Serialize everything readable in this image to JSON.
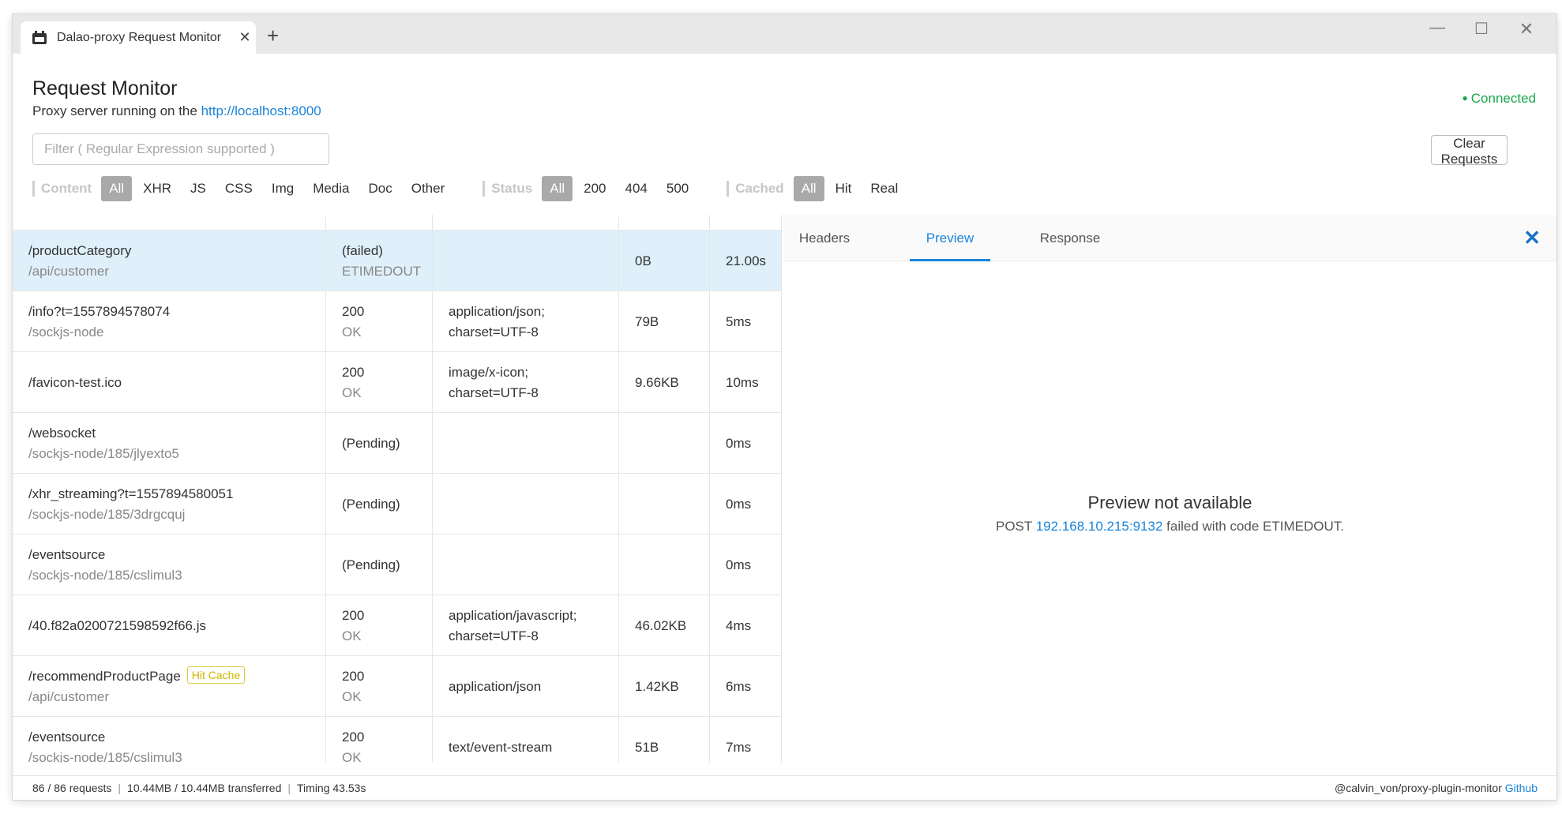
{
  "window": {
    "tab_title": "Dalao-proxy Request Monitor",
    "close_glyph": "✕",
    "new_tab_glyph": "+",
    "min_glyph": "—",
    "max_glyph": "☐",
    "close_window_glyph": "✕"
  },
  "header": {
    "title": "Request Monitor",
    "subtitle_prefix": "Proxy server running on the ",
    "server_url": "http://localhost:8000",
    "connection_status": "Connected",
    "connection_color": "#19a84a"
  },
  "toolbar": {
    "filter_placeholder": "Filter ( Regular Expression supported )",
    "filter_value": "",
    "clear_label": "Clear Requests"
  },
  "filters": {
    "content": {
      "label": "Content",
      "options": [
        "All",
        "XHR",
        "JS",
        "CSS",
        "Img",
        "Media",
        "Doc",
        "Other"
      ],
      "selected": "All"
    },
    "status": {
      "label": "Status",
      "options": [
        "All",
        "200",
        "404",
        "500"
      ],
      "selected": "All"
    },
    "cached": {
      "label": "Cached",
      "options": [
        "All",
        "Hit",
        "Real"
      ],
      "selected": "All"
    }
  },
  "requests": [
    {
      "name": "",
      "path": "/api/customer",
      "status": "",
      "status_text": "ETIMEDOUT",
      "type": "",
      "size": "",
      "time": "",
      "badge": ""
    },
    {
      "name": "/productCategory",
      "path": "/api/customer",
      "status": "(failed)",
      "status_text": "ETIMEDOUT",
      "type": "",
      "size": "0B",
      "time": "21.00s",
      "badge": "",
      "selected": true
    },
    {
      "name": "/info?t=1557894578074",
      "path": "/sockjs-node",
      "status": "200",
      "status_text": "OK",
      "type": "application/json;\ncharset=UTF-8",
      "size": "79B",
      "time": "5ms",
      "badge": ""
    },
    {
      "name": "/favicon-test.ico",
      "path": "",
      "status": "200",
      "status_text": "OK",
      "type": "image/x-icon;\ncharset=UTF-8",
      "size": "9.66KB",
      "time": "10ms",
      "badge": ""
    },
    {
      "name": "/websocket",
      "path": "/sockjs-node/185/jlyexto5",
      "status": "(Pending)",
      "status_text": "",
      "type": "",
      "size": "",
      "time": "0ms",
      "badge": ""
    },
    {
      "name": "/xhr_streaming?t=1557894580051",
      "path": "/sockjs-node/185/3drgcquj",
      "status": "(Pending)",
      "status_text": "",
      "type": "",
      "size": "",
      "time": "0ms",
      "badge": ""
    },
    {
      "name": "/eventsource",
      "path": "/sockjs-node/185/cslimul3",
      "status": "(Pending)",
      "status_text": "",
      "type": "",
      "size": "",
      "time": "0ms",
      "badge": ""
    },
    {
      "name": "/40.f82a0200721598592f66.js",
      "path": "",
      "status": "200",
      "status_text": "OK",
      "type": "application/javascript;\ncharset=UTF-8",
      "size": "46.02KB",
      "time": "4ms",
      "badge": ""
    },
    {
      "name": "/recommendProductPage",
      "path": "/api/customer",
      "status": "200",
      "status_text": "OK",
      "type": "application/json",
      "size": "1.42KB",
      "time": "6ms",
      "badge": "Hit Cache"
    },
    {
      "name": "/eventsource",
      "path": "/sockjs-node/185/cslimul3",
      "status": "200",
      "status_text": "OK",
      "type": "text/event-stream",
      "size": "51B",
      "time": "7ms",
      "badge": ""
    }
  ],
  "detail": {
    "tabs": [
      "Headers",
      "Preview",
      "Response"
    ],
    "active_tab": "Preview",
    "close_glyph": "✕",
    "preview_title": "Preview not available",
    "preview_method": "POST ",
    "preview_ip": "192.168.10.215:9132",
    "preview_suffix": " failed with code ETIMEDOUT."
  },
  "statusbar": {
    "requests": "86 / 86 requests",
    "transferred": "10.44MB / 10.44MB transferred",
    "timing": "Timing 43.53s",
    "credit": "@calvin_von/proxy-plugin-monitor ",
    "github_label": "Github"
  }
}
